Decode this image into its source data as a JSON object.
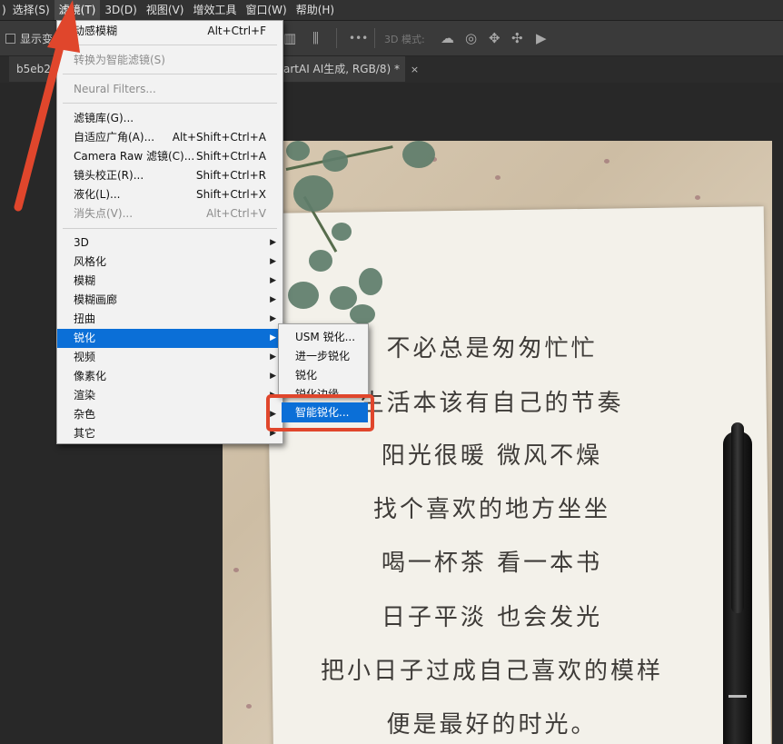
{
  "menubar": {
    "items": [
      ")",
      "选择(S)",
      "滤镜(T)",
      "3D(D)",
      "视图(V)",
      "增效工具",
      "窗口(W)",
      "帮助(H)"
    ]
  },
  "options_bar": {
    "show_label": "显示变",
    "more_label": "•••",
    "mode_3d_label": "3D 模式:"
  },
  "tabs": {
    "left_tab": "b5eb2",
    "right_tab": "artAI AI生成, RGB/8) *",
    "close_glyph": "×"
  },
  "filter_menu": {
    "last_filter": {
      "label": "动感模糊",
      "shortcut": "Alt+Ctrl+F"
    },
    "convert_smart": "转换为智能滤镜(S)",
    "neural_filters": "Neural Filters...",
    "group3": [
      {
        "label": "滤镜库(G)...",
        "shortcut": ""
      },
      {
        "label": "自适应广角(A)...",
        "shortcut": "Alt+Shift+Ctrl+A"
      },
      {
        "label": "Camera Raw 滤镜(C)...",
        "shortcut": "Shift+Ctrl+A"
      },
      {
        "label": "镜头校正(R)...",
        "shortcut": "Shift+Ctrl+R"
      },
      {
        "label": "液化(L)...",
        "shortcut": "Shift+Ctrl+X"
      },
      {
        "label": "消失点(V)...",
        "shortcut": "Alt+Ctrl+V"
      }
    ],
    "submenus": [
      "3D",
      "风格化",
      "模糊",
      "模糊画廊",
      "扭曲",
      "锐化",
      "视频",
      "像素化",
      "渲染",
      "杂色",
      "其它"
    ]
  },
  "sharpen_submenu": {
    "items": [
      "USM 锐化...",
      "进一步锐化",
      "锐化",
      "锐化边缘"
    ],
    "smart_sharpen": "智能锐化..."
  },
  "photo_text": {
    "lines": [
      "不必总是匆匆忙忙",
      "生活本该有自己的节奏",
      "阳光很暖  微风不燥",
      "找个喜欢的地方坐坐",
      "喝一杯茶  看一本书",
      "日子平淡  也会发光",
      "把小日子过成自己喜欢的模样",
      "便是最好的时光。"
    ]
  },
  "colors": {
    "menu_highlight": "#0b6fd7",
    "annotation": "#e0462c",
    "menu_bg": "#f2f2f2"
  }
}
